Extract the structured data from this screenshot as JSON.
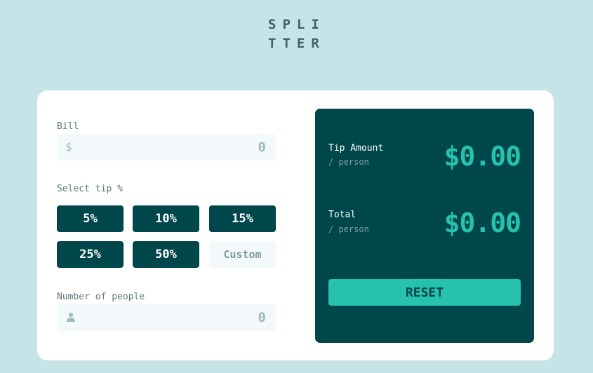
{
  "logo": {
    "line1": "SPLI",
    "line2": "TTER"
  },
  "bill": {
    "label": "Bill",
    "currency_symbol": "$",
    "value": "0"
  },
  "tip": {
    "label": "Select tip %",
    "options": [
      "5%",
      "10%",
      "15%",
      "25%",
      "50%"
    ],
    "custom_placeholder": "Custom"
  },
  "people": {
    "label": "Number of people",
    "value": "0",
    "icon": "person-icon"
  },
  "results": {
    "tip_amount": {
      "title": "Tip Amount",
      "sub": "/ person",
      "value": "$0.00"
    },
    "total": {
      "title": "Total",
      "sub": "/ person",
      "value": "$0.00"
    },
    "reset_label": "RESET"
  },
  "colors": {
    "background": "#c5e4e7",
    "panel": "#00474b",
    "accent": "#26c2ae",
    "input_bg": "#f3f9fa"
  }
}
